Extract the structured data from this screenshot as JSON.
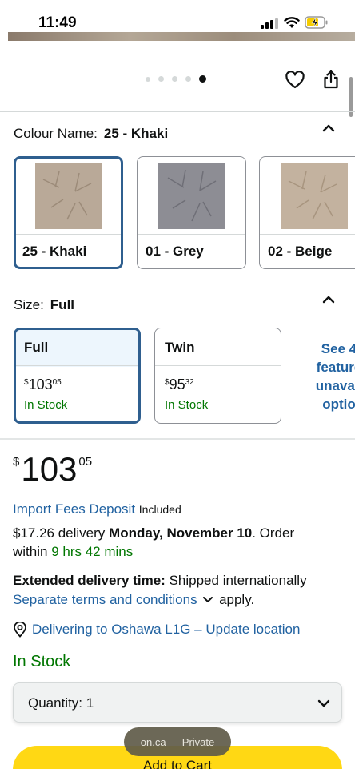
{
  "status": {
    "time": "11:49"
  },
  "carousel": {
    "dot_count": 5,
    "active_index": 4
  },
  "colour": {
    "label": "Colour Name:",
    "selected": "25 - Khaki",
    "options": [
      {
        "name": "25 - Khaki",
        "color": "#b9a998"
      },
      {
        "name": "01 - Grey",
        "color": "#8d8d94"
      },
      {
        "name": "02 - Beige",
        "color": "#c3b29f"
      }
    ]
  },
  "size": {
    "label": "Size:",
    "selected": "Full",
    "options": [
      {
        "name": "Full",
        "currency": "$",
        "whole": "103",
        "fraction": "05",
        "stock": "In Stock"
      },
      {
        "name": "Twin",
        "currency": "$",
        "whole": "95",
        "fraction": "32",
        "stock": "In Stock"
      }
    ],
    "see_more_lines": [
      "See 4",
      "feature",
      "unavail",
      "optio"
    ]
  },
  "price": {
    "currency": "$",
    "whole": "103",
    "fraction": "05"
  },
  "import_fees": {
    "link": "Import Fees Deposit",
    "text": "Included"
  },
  "delivery": {
    "prefix": "$17.26 delivery",
    "date": "Monday, November 10",
    "order_text": ". Order",
    "within_text": "within",
    "countdown": "9 hrs 42 mins"
  },
  "extended": {
    "label": "Extended delivery time:",
    "text": "Shipped internationally",
    "terms_link": "Separate terms and conditions",
    "apply": "apply."
  },
  "location": {
    "text": "Delivering to Oshawa L1G – Update location"
  },
  "stock": "In Stock",
  "quantity": {
    "label": "Quantity: 1"
  },
  "cart": {
    "label": "Add to Cart"
  },
  "browser_pill": {
    "text": "on.ca — Private"
  },
  "colors": {
    "accent_blue": "#2162a1",
    "selected_border": "#2f5f8f",
    "in_stock_green": "#007600",
    "cart_yellow": "#ffd814"
  }
}
